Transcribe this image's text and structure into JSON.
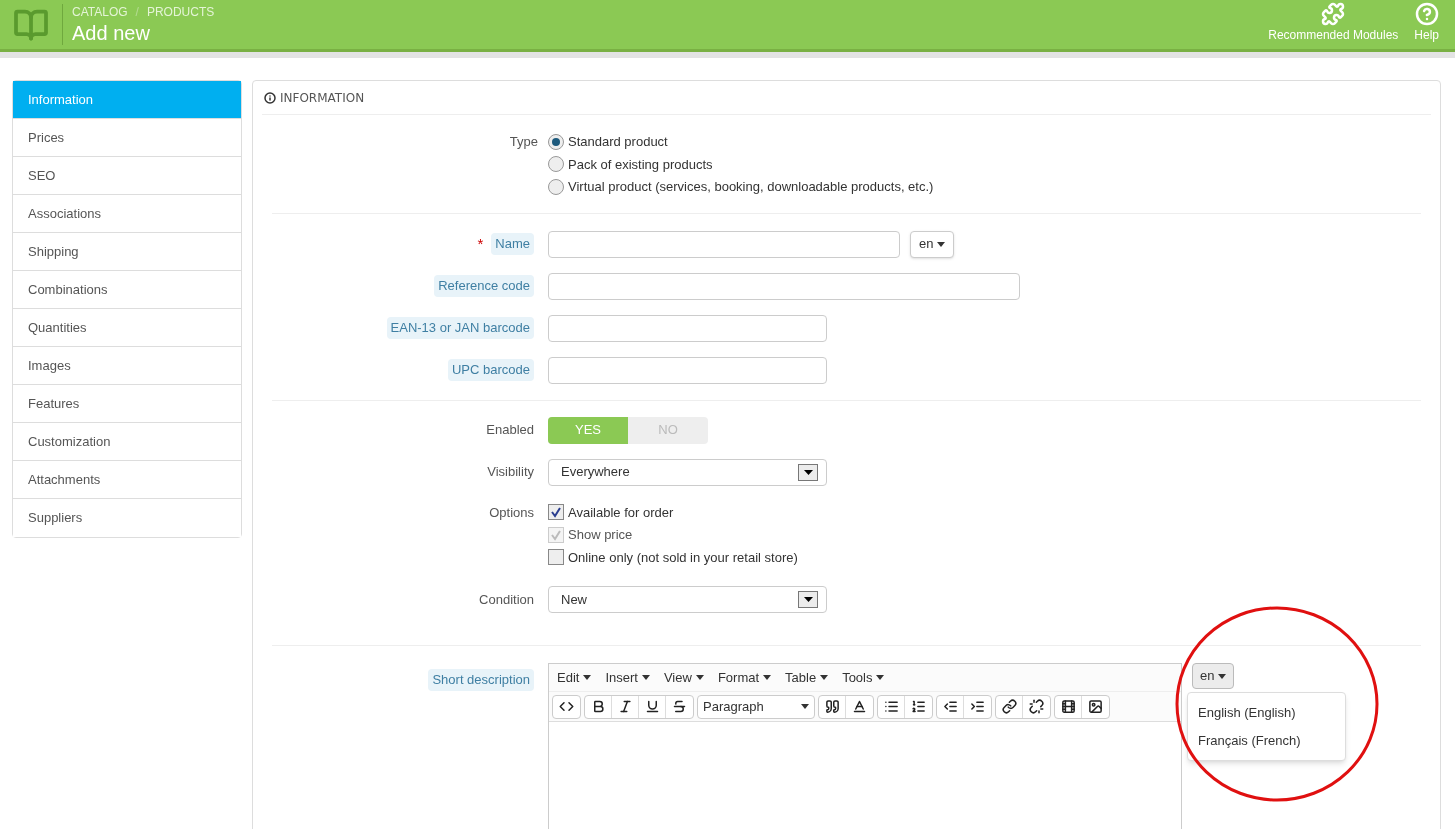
{
  "header": {
    "breadcrumb": [
      "CATALOG",
      "PRODUCTS"
    ],
    "separator": "/",
    "title": "Add new",
    "actions": [
      {
        "label": "Recommended Modules",
        "kind": "puzzle"
      },
      {
        "label": "Help",
        "kind": "help"
      }
    ]
  },
  "sidebar": {
    "items": [
      {
        "label": "Information",
        "selected": true
      },
      {
        "label": "Prices",
        "selected": false
      },
      {
        "label": "SEO",
        "selected": false
      },
      {
        "label": "Associations",
        "selected": false
      },
      {
        "label": "Shipping",
        "selected": false
      },
      {
        "label": "Combinations",
        "selected": false
      },
      {
        "label": "Quantities",
        "selected": false
      },
      {
        "label": "Images",
        "selected": false
      },
      {
        "label": "Features",
        "selected": false
      },
      {
        "label": "Customization",
        "selected": false
      },
      {
        "label": "Attachments",
        "selected": false
      },
      {
        "label": "Suppliers",
        "selected": false
      }
    ]
  },
  "panel": {
    "title": "INFORMATION",
    "type": {
      "label": "Type",
      "options": [
        {
          "label": "Standard product",
          "selected": true
        },
        {
          "label": "Pack of existing products",
          "selected": false
        },
        {
          "label": "Virtual product (services, booking, downloadable products, etc.)",
          "selected": false
        }
      ]
    },
    "fields": [
      {
        "label": "Name",
        "kind": "name",
        "required_mark": "*",
        "lang": "en"
      },
      {
        "label": "Reference code",
        "kind": "long"
      },
      {
        "label": "EAN-13 or JAN barcode",
        "kind": "short"
      },
      {
        "label": "UPC barcode",
        "kind": "short"
      }
    ],
    "enabled": {
      "label": "Enabled",
      "options": [
        {
          "label": "YES",
          "selected": true
        },
        {
          "label": "NO",
          "selected": false
        }
      ]
    },
    "visibility": {
      "label": "Visibility",
      "value": "Everywhere"
    },
    "options": {
      "label": "Options",
      "items": [
        {
          "label": "Available for order",
          "checked": true,
          "disabled": false
        },
        {
          "label": "Show price",
          "checked": true,
          "disabled": true
        },
        {
          "label": "Online only (not sold in your retail store)",
          "checked": false,
          "disabled": false
        }
      ]
    },
    "condition": {
      "label": "Condition",
      "value": "New"
    },
    "short_description": {
      "label": "Short description",
      "menus": [
        "Edit",
        "Insert",
        "View",
        "Format",
        "Table",
        "Tools"
      ],
      "format": "Paragraph",
      "lang": "en",
      "lang_menu": [
        "English (English)",
        "Français (French)"
      ]
    }
  }
}
